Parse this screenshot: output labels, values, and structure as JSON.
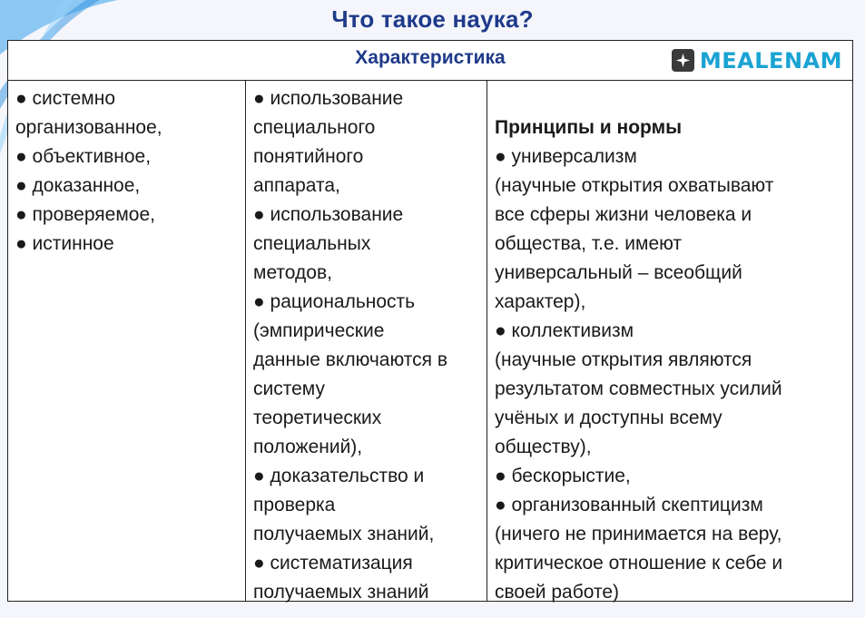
{
  "page": {
    "title": "Что такое наука?"
  },
  "table": {
    "header": "Характеристика",
    "logo_text": "MEALENAM",
    "col1": "● системно\nорганизованное,\n● объективное,\n● доказанное,\n● проверяемое,\n● истинное",
    "col2": "● использование\nспециального\nпонятийного\nаппарата,\n● использование\nспециальных\nметодов,\n● рациональность\n(эмпирические\nданные включаются в\nсистему\nтеоретических\nположений),\n● доказательство и\nпроверка\nполучаемых знаний,\n● систематизация\nполучаемых знаний",
    "col3_heading": "Принципы и нормы",
    "col3": "●  универсализм\n(научные открытия охватывают\nвсе сферы жизни человека и\nобщества, т.е. имеют\nуниверсальный – всеобщий\nхарактер),\n● коллективизм\n(научные открытия являются\nрезультатом совместных усилий\nучёных и доступны всему\nобществу),\n● бескорыстие,\n● организованный скептицизм\n(ничего не принимается на веру,\nкритическое отношение к себе и\nсвоей работе)"
  },
  "colors": {
    "title": "#1f3a8a",
    "logo": "#1aa3d3",
    "accent_swoosh": "#2f8fe0"
  }
}
